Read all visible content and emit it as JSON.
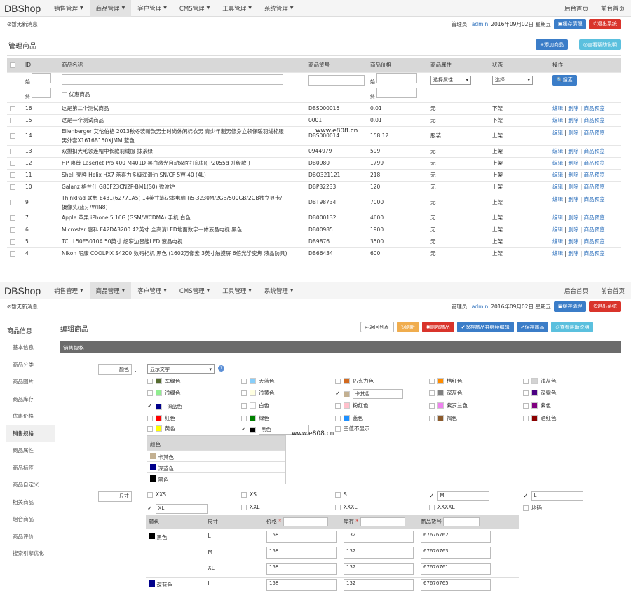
{
  "brand": "DBShop",
  "nav": {
    "items": [
      "销售管理",
      "商品管理",
      "客户管理",
      "CMS管理",
      "工具管理",
      "系统管理"
    ],
    "active": 1,
    "right": [
      "后台首页",
      "前台首页"
    ]
  },
  "info": {
    "message": "暂无新消息",
    "admin_label": "管理员:",
    "admin_name": "admin",
    "date": "2016年09月02日 星期五",
    "clear_cache": "缓存清理",
    "logout": "退出系统"
  },
  "list": {
    "title": "管理商品",
    "add_button": "添加商品",
    "help_button": "查看帮助说明",
    "headers": [
      "ID",
      "商品名称",
      "商品货号",
      "商品价格",
      "商品属性",
      "状态",
      "操作"
    ],
    "filter": {
      "start": "始",
      "end": "终",
      "special": "优惠商品",
      "attr_select": "选择属性",
      "status_select": "选择",
      "search_button": "搜索"
    },
    "actions": [
      "编辑",
      "删除",
      "商品预览"
    ],
    "rows": [
      {
        "id": "16",
        "name": "这是第二个测试商品",
        "sku": "DBS000016",
        "price": "0.01",
        "attr": "无",
        "status": "下架"
      },
      {
        "id": "15",
        "name": "这是一个测试商品",
        "sku": "0001",
        "price": "0.01",
        "attr": "无",
        "status": "下架"
      },
      {
        "id": "14",
        "name": "Ellenberger 艾伦伯格 2013秋冬装新款男士时尚休闲棉衣男 青少年制男修身立领保暖羽绒棉服男外套X1616B150XJMM 蓝色",
        "sku": "DBS000014",
        "price": "158.12",
        "attr": "服装",
        "status": "上架"
      },
      {
        "id": "13",
        "name": "双排扣大毛领连帽中长款羽绒服 抹茶绿",
        "sku": "0944979",
        "price": "599",
        "attr": "无",
        "status": "上架"
      },
      {
        "id": "12",
        "name": "HP 惠普 LaserJet Pro 400 M401D 黑白激光自动双面打印机( P2055d 升级款 )",
        "sku": "DB0980",
        "price": "1799",
        "attr": "无",
        "status": "上架"
      },
      {
        "id": "11",
        "name": "Shell 壳牌 Helix HX7 蓝喜力多级润滑油 SN/CF 5W-40 (4L)",
        "sku": "DBQ321121",
        "price": "218",
        "attr": "无",
        "status": "上架"
      },
      {
        "id": "10",
        "name": "Galanz 格兰仕 G80F23CN2P-BM1(S0) 微波炉",
        "sku": "DBP32233",
        "price": "120",
        "attr": "无",
        "status": "上架"
      },
      {
        "id": "9",
        "name": "ThinkPad 联想 E431(62771A5) 14英寸笔记本电脑 (i5-3230M/2GB/500GB/2GB独立显卡/摄像头/蓝牙/WIN8)",
        "sku": "DBT98734",
        "price": "7000",
        "attr": "无",
        "status": "上架"
      },
      {
        "id": "7",
        "name": "Apple 苹果 iPhone 5 16G (GSM/WCDMA) 手机 白色",
        "sku": "DB000132",
        "price": "4600",
        "attr": "无",
        "status": "上架"
      },
      {
        "id": "6",
        "name": "Microstar 惠科 F42DA3200 42英寸 全高清LED地面数字一体液晶电视 黑色",
        "sku": "DB00985",
        "price": "1900",
        "attr": "无",
        "status": "上架"
      },
      {
        "id": "5",
        "name": "TCL L50E5010A 50英寸 超窄边智能LED 液晶电视",
        "sku": "DB9876",
        "price": "3500",
        "attr": "无",
        "status": "上架"
      },
      {
        "id": "4",
        "name": "Nikon 尼康 COOLPIX S4200 数码相机 黑色 (1602万像素 3英寸触摸屏 6倍光学变焦 液晶防具)",
        "sku": "DB66434",
        "price": "600",
        "attr": "无",
        "status": "上架"
      }
    ],
    "watermark": "www.e808.cn"
  },
  "edit": {
    "title": "编辑商品",
    "buttons": {
      "back": "返回列表",
      "reset": "刷新",
      "delete": "删除商品",
      "save_continue": "保存商品并继续编辑",
      "save": "保存商品",
      "help": "查看帮助说明"
    },
    "section": "销售规格",
    "sidebar": {
      "title": "商品信息",
      "items": [
        "基本信息",
        "商品分类",
        "商品图片",
        "商品库存",
        "优惠价格",
        "销售规格",
        "商品属性",
        "商品标签",
        "商品自定义",
        "相关商品",
        "组合商品",
        "商品评价",
        "搜索引擎优化"
      ],
      "active": 5
    },
    "color_label": "颜色",
    "color_select": "显示文字",
    "colors": [
      {
        "name": "军绿色",
        "hex": "#556b2f",
        "checked": false
      },
      {
        "name": "天蓝色",
        "hex": "#87cefa",
        "checked": false
      },
      {
        "name": "巧克力色",
        "hex": "#d2691e",
        "checked": false
      },
      {
        "name": "桔红色",
        "hex": "#ff8c00",
        "checked": false
      },
      {
        "name": "浅灰色",
        "hex": "#d3d3d3",
        "checked": false
      },
      {
        "name": "浅绿色",
        "hex": "#90ee90",
        "checked": false
      },
      {
        "name": "浅黄色",
        "hex": "#ffffe0",
        "checked": false
      },
      {
        "name": "卡其色",
        "hex": "#c3b091",
        "checked": true
      },
      {
        "name": "深灰色",
        "hex": "#808080",
        "checked": false
      },
      {
        "name": "深紫色",
        "hex": "#4b0082",
        "checked": false
      },
      {
        "name": "深蓝色",
        "hex": "#00008b",
        "checked": true
      },
      {
        "name": "白色",
        "hex": "#ffffff",
        "checked": false
      },
      {
        "name": "粉红色",
        "hex": "#ffc0cb",
        "checked": false
      },
      {
        "name": "紫罗兰色",
        "hex": "#ee82ee",
        "checked": false
      },
      {
        "name": "紫色",
        "hex": "#800080",
        "checked": false
      },
      {
        "name": "红色",
        "hex": "#ff0000",
        "checked": false
      },
      {
        "name": "绿色",
        "hex": "#008000",
        "checked": false
      },
      {
        "name": "蓝色",
        "hex": "#1e90ff",
        "checked": false
      },
      {
        "name": "褐色",
        "hex": "#8b5a2b",
        "checked": false
      },
      {
        "name": "酒红色",
        "hex": "#8b0000",
        "checked": false
      },
      {
        "name": "黄色",
        "hex": "#ffff00",
        "checked": false
      },
      {
        "name": "黑色",
        "hex": "#000000",
        "checked": true
      },
      {
        "name": "空值不显示",
        "hex": "",
        "checked": false
      }
    ],
    "color_table": {
      "header": "颜色",
      "rows": [
        "卡其色",
        "深蓝色",
        "黑色"
      ]
    },
    "size_label": "尺寸",
    "sizes": [
      {
        "name": "XXS",
        "checked": false
      },
      {
        "name": "XS",
        "checked": false
      },
      {
        "name": "S",
        "checked": false
      },
      {
        "name": "M",
        "checked": true
      },
      {
        "name": "L",
        "checked": true
      },
      {
        "name": "XL",
        "checked": true
      },
      {
        "name": "XXL",
        "checked": false
      },
      {
        "name": "XXXL",
        "checked": false
      },
      {
        "name": "XXXXL",
        "checked": false
      },
      {
        "name": "均码",
        "checked": false
      }
    ],
    "combo": {
      "headers": [
        "颜色",
        "尺寸",
        "价格",
        "库存",
        "商品货号"
      ],
      "color": "黑色",
      "rows": [
        {
          "size": "L",
          "price": "158",
          "stock": "132",
          "sku": "67676762"
        },
        {
          "size": "M",
          "price": "158",
          "stock": "132",
          "sku": "67676763"
        },
        {
          "size": "XL",
          "price": "158",
          "stock": "132",
          "sku": "67676761"
        }
      ],
      "next_color": "深蓝色",
      "next_size": "L",
      "next_price": "158",
      "next_stock": "132",
      "next_sku": "67676765"
    },
    "watermark": "www.e808.cn"
  }
}
